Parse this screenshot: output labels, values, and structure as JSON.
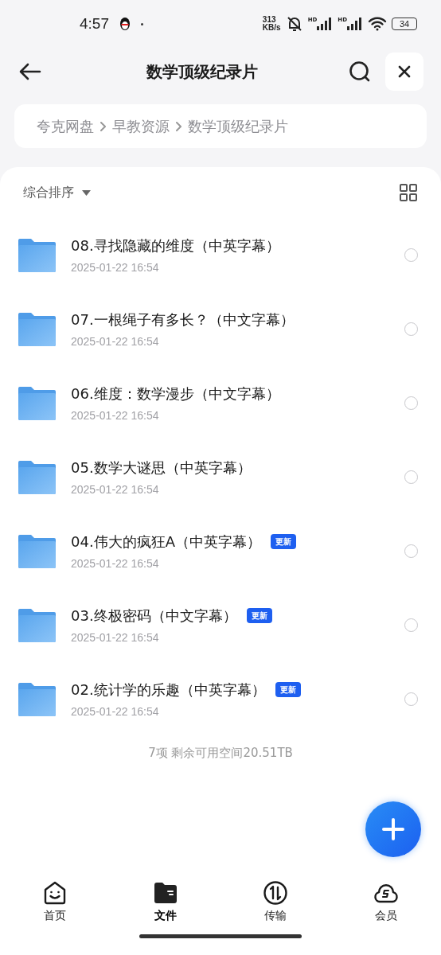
{
  "status_bar": {
    "time": "4:57",
    "speed_value": "313",
    "speed_unit": "KB/s",
    "signal_1": "HD",
    "signal_2": "HD",
    "battery": "34"
  },
  "header": {
    "title": "数学顶级纪录片"
  },
  "breadcrumb": [
    "夸克网盘",
    "早教资源",
    "数学顶级纪录片"
  ],
  "sort": {
    "label": "综合排序"
  },
  "files": [
    {
      "name": "08.寻找隐藏的维度（中英字幕）",
      "date": "2025-01-22 16:54",
      "checked": false
    },
    {
      "name": "07.一根绳子有多长？（中文字幕）",
      "date": "2025-01-22 16:54",
      "checked": false
    },
    {
      "name": "06.维度：数学漫步（中文字幕）",
      "date": "2025-01-22 16:54",
      "checked": false
    },
    {
      "name": "05.数学大谜思（中英字幕）",
      "date": "2025-01-22 16:54",
      "checked": false
    },
    {
      "name": "04.伟大的疯狂A（中英字幕）",
      "date": "2025-01-22 16:54",
      "badge": "更新",
      "checked": false
    },
    {
      "name": "03.终极密码（中文字幕）",
      "date": "2025-01-22 16:54",
      "badge": "更新",
      "checked": false
    },
    {
      "name": "02.统计学的乐趣（中英字幕）",
      "date": "2025-01-22 16:54",
      "badge": "更新",
      "checked": false
    }
  ],
  "footer": "7项 剩余可用空间20.51TB",
  "nav": [
    {
      "kind": "home",
      "label": "首页",
      "selected": false
    },
    {
      "kind": "files",
      "label": "文件",
      "selected": true
    },
    {
      "kind": "transfer",
      "label": "传输",
      "selected": false
    },
    {
      "kind": "vip",
      "label": "会员",
      "selected": false
    }
  ]
}
